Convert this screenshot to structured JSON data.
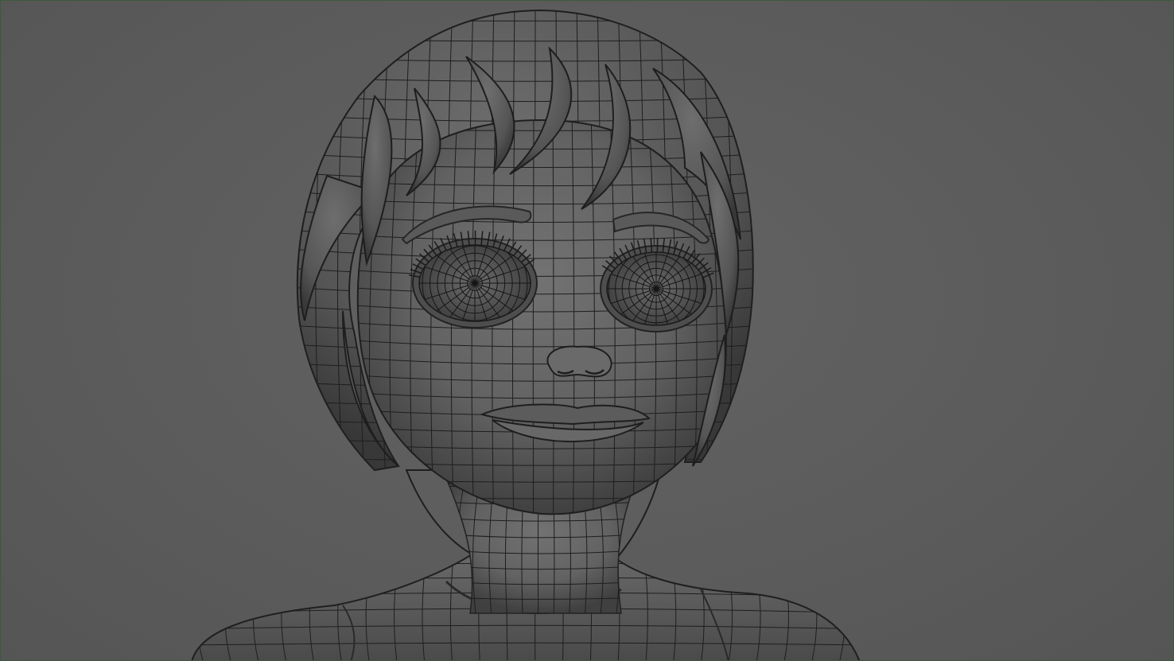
{
  "viewport": {
    "kind": "3d-modeling-viewport",
    "display_mode": "smooth-shaded-with-wireframe",
    "model": "stylized-character-head-bust",
    "colors": {
      "background": "#5d5d5d",
      "frame_border": "#3b5a3b",
      "mesh_fill": "#6a6a6a",
      "mesh_shadow": "#3c3c3c",
      "wire": "#1e1e1e"
    }
  }
}
